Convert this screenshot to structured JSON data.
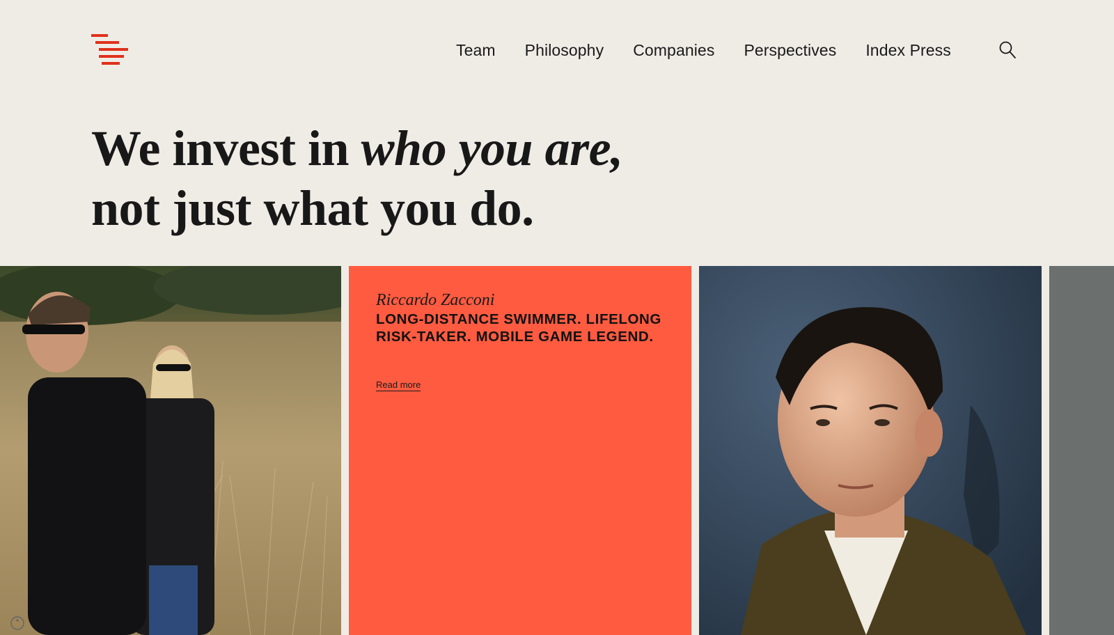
{
  "brand": {
    "logo_icon": "index-ventures-logo-icon",
    "accent": "#e0311b"
  },
  "nav": {
    "items": [
      {
        "label": "Team"
      },
      {
        "label": "Philosophy"
      },
      {
        "label": "Companies"
      },
      {
        "label": "Perspectives"
      },
      {
        "label": "Index Press"
      }
    ],
    "search_icon": "search-icon"
  },
  "hero": {
    "line1_prefix": "We invest in ",
    "line1_emphasis": "who you are,",
    "line2": "not just what you do."
  },
  "cards": [
    {
      "type": "photo",
      "image_alt": "Two people in sunglasses standing in a golden grass field"
    },
    {
      "type": "quote",
      "name": "Riccardo Zacconi",
      "text": "LONG-DISTANCE SWIMMER. LIFELONG RISK-TAKER. MOBILE GAME LEGEND.",
      "link_label": "Read more",
      "background": "#fe5b40"
    },
    {
      "type": "photo",
      "image_alt": "Portrait of a young man with dark hair against a blue wall"
    },
    {
      "type": "photo",
      "image_alt": "Partial grey photo"
    }
  ],
  "colors": {
    "background": "#efece6",
    "text": "#1a1a1a",
    "card_coral": "#fe5b40"
  }
}
